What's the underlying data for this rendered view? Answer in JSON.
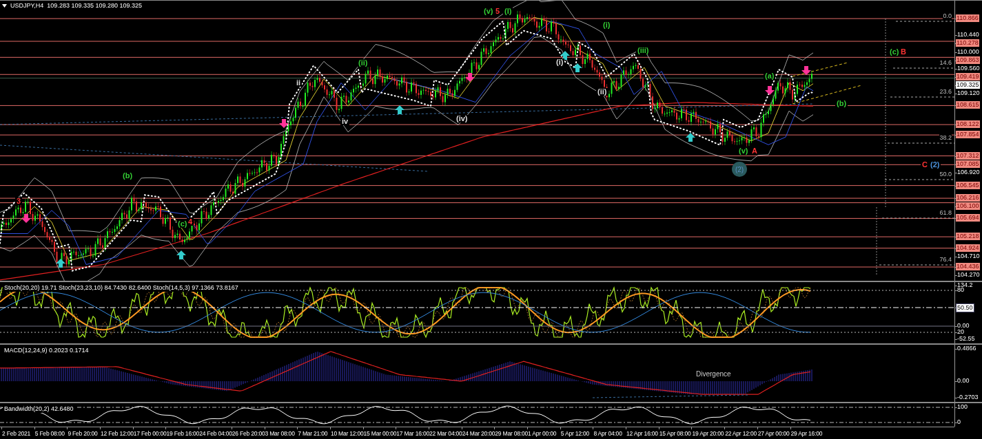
{
  "chart": {
    "symbol": "USDJPY,H4",
    "ohlc": "109.283 109.335 109.280 109.325"
  },
  "price_axis": [
    {
      "text": "110.866",
      "kind": "level"
    },
    {
      "text": "110.440",
      "kind": "plain"
    },
    {
      "text": "110.278",
      "kind": "level"
    },
    {
      "text": "110.000",
      "kind": "plain"
    },
    {
      "text": "109.863",
      "kind": "level"
    },
    {
      "text": "109.560",
      "kind": "plain"
    },
    {
      "text": "109.419",
      "kind": "level"
    },
    {
      "text": "109.325",
      "kind": "current"
    },
    {
      "text": "109.120",
      "kind": "plain"
    },
    {
      "text": "108.615",
      "kind": "level"
    },
    {
      "text": "108.122",
      "kind": "level"
    },
    {
      "text": "107.854",
      "kind": "level"
    },
    {
      "text": "107.312",
      "kind": "level"
    },
    {
      "text": "107.085",
      "kind": "level"
    },
    {
      "text": "106.920",
      "kind": "plain"
    },
    {
      "text": "106.545",
      "kind": "level"
    },
    {
      "text": "106.216",
      "kind": "level"
    },
    {
      "text": "106.100",
      "kind": "level"
    },
    {
      "text": "105.694",
      "kind": "level"
    },
    {
      "text": "105.218",
      "kind": "level"
    },
    {
      "text": "104.924",
      "kind": "level"
    },
    {
      "text": "104.710",
      "kind": "plain"
    },
    {
      "text": "104.436",
      "kind": "level"
    },
    {
      "text": "104.270",
      "kind": "plain"
    }
  ],
  "fibonacci_levels": [
    "0.0",
    "14.6",
    "23.6",
    "38.2",
    "50.0",
    "61.8",
    "76.4"
  ],
  "wave_labels": [
    {
      "text": "(v)",
      "color": "#33cc33"
    },
    {
      "text": "5",
      "color": "#ff3333"
    },
    {
      "text": "(I)",
      "color": "#33cc33"
    },
    {
      "text": "(i)",
      "color": "#33cc33"
    },
    {
      "text": "(ii)",
      "color": "#33cc33"
    },
    {
      "text": "(iii)",
      "color": "#33cc33"
    },
    {
      "text": "(i)",
      "color": "#dddddd"
    },
    {
      "text": "(ii)",
      "color": "#dddddd"
    },
    {
      "text": "ii",
      "color": "#dddddd"
    },
    {
      "text": "iv",
      "color": "#dddddd"
    },
    {
      "text": "(iv)",
      "color": "#dddddd"
    },
    {
      "text": "(b)",
      "color": "#33cc33"
    },
    {
      "text": "3",
      "color": "#ff3333"
    },
    {
      "text": "(c)",
      "color": "#33cc33"
    },
    {
      "text": "4",
      "color": "#ff3333"
    },
    {
      "text": "(a)",
      "color": "#33cc33"
    },
    {
      "text": "(b)",
      "color": "#33cc33"
    },
    {
      "text": "(v)",
      "color": "#33cc33"
    },
    {
      "text": "A",
      "color": "#ff3333"
    },
    {
      "text": "(c)",
      "color": "#33cc33"
    },
    {
      "text": "B",
      "color": "#ff3333"
    },
    {
      "text": "C",
      "color": "#ff3333"
    },
    {
      "text": "(2)",
      "color": "#4a90d9"
    }
  ],
  "circle_label": "(2)",
  "indicators": [
    {
      "kind": "stoch",
      "label": "Stoch(20,20) 19.71 Stoch(23,23,10) 84.7430 82.6400 Stoch(14,5,3) 97.1366 73.8167",
      "axis": [
        {
          "text": "134.2",
          "kind": "plain"
        },
        {
          "text": "80",
          "kind": "plain"
        },
        {
          "text": "50.50",
          "kind": "boxed"
        },
        {
          "text": "0.00",
          "kind": "plain"
        },
        {
          "text": "20",
          "kind": "plain"
        },
        {
          "text": "-52.55",
          "kind": "plain"
        }
      ]
    },
    {
      "kind": "macd",
      "label": "MACD(12,24,9) 0.2023 0.1714",
      "annotation": "Divergence",
      "axis": [
        {
          "text": "0.4866",
          "kind": "plain"
        },
        {
          "text": "0.00",
          "kind": "plain"
        },
        {
          "text": "-0.2703",
          "kind": "plain"
        }
      ]
    },
    {
      "kind": "bandwidth",
      "label": "Bandwidth(20,2) 42.6480",
      "axis": [
        {
          "text": "100",
          "kind": "plain"
        },
        {
          "text": "0",
          "kind": "plain"
        }
      ]
    }
  ],
  "time_axis": [
    "2 Feb 2021",
    "5 Feb 08:00",
    "9 Feb 20:00",
    "12 Feb 12:00",
    "17 Feb 00:00",
    "19 Feb 16:00",
    "24 Feb 04:00",
    "26 Feb 20:00",
    "3 Mar 08:00",
    "7 Mar 21:00",
    "10 Mar 12:00",
    "15 Mar 00:00",
    "17 Mar 16:00",
    "22 Mar 04:00",
    "24 Mar 20:00",
    "29 Mar 08:00",
    "1 Apr 00:00",
    "5 Apr 12:00",
    "8 Apr 04:00",
    "12 Apr 16:00",
    "15 Apr 08:00",
    "19 Apr 20:00",
    "22 Apr 12:00",
    "27 Apr 00:00",
    "29 Apr 16:00"
  ]
}
